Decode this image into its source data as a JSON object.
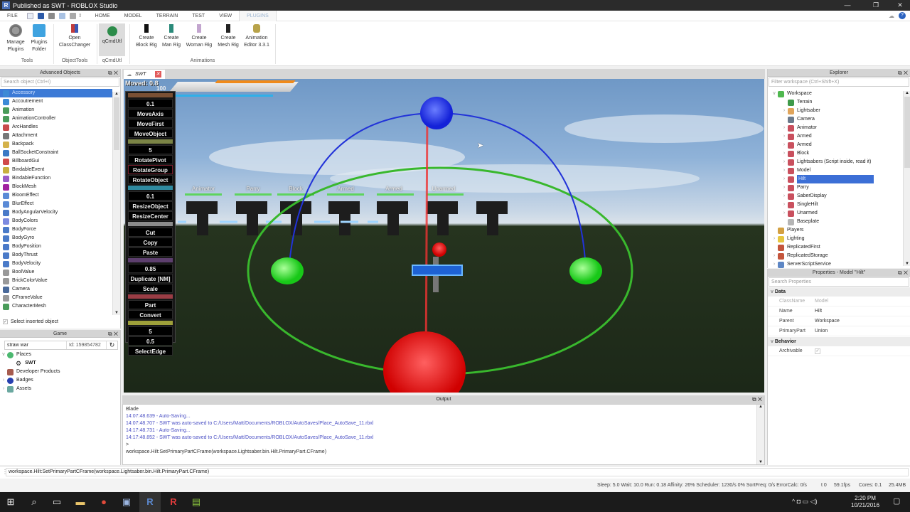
{
  "window": {
    "title": "Published as SWT - ROBLOX Studio",
    "logo": "R"
  },
  "menu": {
    "file": "FILE",
    "tabs": [
      "HOME",
      "MODEL",
      "TERRAIN",
      "TEST",
      "VIEW",
      "PLUGINS"
    ],
    "active_tab": "PLUGINS"
  },
  "ribbon": {
    "buttons": [
      {
        "label1": "Manage",
        "label2": "Plugins",
        "icon": "plug-icon"
      },
      {
        "label1": "Plugins",
        "label2": "Folder",
        "icon": "folder-icon"
      },
      {
        "label1": "Open",
        "label2": "ClassChanger",
        "icon": "class-changer-icon"
      },
      {
        "label1": "qCmdUtl",
        "label2": "",
        "icon": "qcmdutl-icon"
      },
      {
        "label1": "Create",
        "label2": "Block Rig",
        "icon": "block-rig-icon"
      },
      {
        "label1": "Create",
        "label2": "Man Rig",
        "icon": "man-rig-icon"
      },
      {
        "label1": "Create",
        "label2": "Woman Rig",
        "icon": "woman-rig-icon"
      },
      {
        "label1": "Create",
        "label2": "Mesh Rig",
        "icon": "mesh-rig-icon"
      },
      {
        "label1": "Animation",
        "label2": "Editor 3.3.1",
        "icon": "animation-editor-icon"
      }
    ],
    "groups": [
      "Tools",
      "ObjectTools",
      "qCmdUtl",
      "Animations"
    ]
  },
  "advanced_objects": {
    "title": "Advanced Objects",
    "search_placeholder": "Search object (Ctrl+I)",
    "items": [
      "Accessory",
      "Accoutrement",
      "Animation",
      "AnimationController",
      "ArcHandles",
      "Attachment",
      "Backpack",
      "BallSocketConstraint",
      "BillboardGui",
      "BindableEvent",
      "BindableFunction",
      "BlockMesh",
      "BloomEffect",
      "BlurEffect",
      "BodyAngularVelocity",
      "BodyColors",
      "BodyForce",
      "BodyGyro",
      "BodyPosition",
      "BodyThrust",
      "BodyVelocity",
      "BoolValue",
      "BrickColorValue",
      "Camera",
      "CFrameValue",
      "CharacterMesh"
    ],
    "selected": "Accessory",
    "select_inserted_label": "Select inserted object",
    "select_inserted_checked": true
  },
  "game": {
    "title": "Game",
    "name_value": "straw war",
    "id_label": "Id: 159854782",
    "tree": [
      {
        "label": "Places",
        "expanded": true,
        "level": 0
      },
      {
        "label": "SWT",
        "level": 1
      },
      {
        "label": "Developer Products",
        "level": 0
      },
      {
        "label": "Badges",
        "level": 0
      },
      {
        "label": "Assets",
        "level": 0
      }
    ]
  },
  "doc_tab": {
    "label": "SWT"
  },
  "viewport": {
    "moved_label": "Moved: 0.8",
    "moved_value": "100",
    "character_labels": [
      "Animator",
      "Parry",
      "Block",
      "Armed",
      "Armed",
      "Unarmed"
    ],
    "cmd_panel": {
      "groups": [
        {
          "color": "#7a5034",
          "items": [
            "0.1",
            "MoveAxis",
            "MoveFirst",
            "MoveObject"
          ]
        },
        {
          "color": "#7b8446",
          "items": [
            "5",
            "RotatePivot",
            "RotateGroup",
            "RotateObject"
          ]
        },
        {
          "color": "#2f8aa0",
          "items": [
            "0.1",
            "ResizeObject",
            "ResizeCenter"
          ]
        },
        {
          "color": "#8c8c8c",
          "items": [
            "Cut",
            "Copy",
            "Paste"
          ]
        },
        {
          "color": "#5d3f6e",
          "items": [
            "0.85",
            "Duplicate [NM]",
            "Scale"
          ]
        },
        {
          "color": "#9b3d45",
          "items": [
            "Part",
            "Convert"
          ]
        },
        {
          "color": "#9ea03a",
          "items": [
            "5",
            "0.5",
            "SelectEdge"
          ]
        }
      ]
    }
  },
  "explorer": {
    "title": "Explorer",
    "filter_placeholder": "Filter workspace (Ctrl+Shift+X)",
    "items": [
      {
        "label": "Workspace",
        "level": 0,
        "arrow": "v",
        "icon": "#4fb84f"
      },
      {
        "label": "Terrain",
        "level": 1,
        "arrow": "",
        "icon": "#3f9a4a"
      },
      {
        "label": "Lightsaber",
        "level": 1,
        "arrow": ">",
        "icon": "#e0a55c"
      },
      {
        "label": "Camera",
        "level": 1,
        "arrow": "",
        "icon": "#6b7a8c"
      },
      {
        "label": "Animator",
        "level": 1,
        "arrow": ">",
        "icon": "#c9505e"
      },
      {
        "label": "Armed",
        "level": 1,
        "arrow": ">",
        "icon": "#c9505e"
      },
      {
        "label": "Armed",
        "level": 1,
        "arrow": ">",
        "icon": "#c9505e"
      },
      {
        "label": "Block",
        "level": 1,
        "arrow": ">",
        "icon": "#c9505e"
      },
      {
        "label": "Lightsabers (Script inside, read it)",
        "level": 1,
        "arrow": ">",
        "icon": "#c9505e"
      },
      {
        "label": "Model",
        "level": 1,
        "arrow": ">",
        "icon": "#c9505e"
      },
      {
        "label": "Hilt",
        "level": 1,
        "arrow": ">",
        "icon": "#c9505e",
        "selected": true
      },
      {
        "label": "Parry",
        "level": 1,
        "arrow": ">",
        "icon": "#c9505e"
      },
      {
        "label": "SaberDisplay",
        "level": 1,
        "arrow": ">",
        "icon": "#c9505e"
      },
      {
        "label": "SingleHilt",
        "level": 1,
        "arrow": ">",
        "icon": "#c9505e"
      },
      {
        "label": "Unarmed",
        "level": 1,
        "arrow": ">",
        "icon": "#c9505e"
      },
      {
        "label": "Baseplate",
        "level": 1,
        "arrow": "",
        "icon": "#b5b5b5"
      },
      {
        "label": "Players",
        "level": 0,
        "arrow": "",
        "icon": "#d3a042"
      },
      {
        "label": "Lighting",
        "level": 0,
        "arrow": ">",
        "icon": "#e6c640"
      },
      {
        "label": "ReplicatedFirst",
        "level": 0,
        "arrow": "",
        "icon": "#c4553c"
      },
      {
        "label": "ReplicatedStorage",
        "level": 0,
        "arrow": ">",
        "icon": "#c4553c"
      },
      {
        "label": "ServerScriptService",
        "level": 0,
        "arrow": ">",
        "icon": "#5d86c4"
      }
    ]
  },
  "properties": {
    "title": "Properties - Model \"Hilt\"",
    "search_placeholder": "Search Properties",
    "sections": [
      {
        "name": "Data",
        "rows": [
          {
            "key": "ClassName",
            "value": "Model",
            "disabled": true
          },
          {
            "key": "Name",
            "value": "Hilt"
          },
          {
            "key": "Parent",
            "value": "Workspace"
          },
          {
            "key": "PrimaryPart",
            "value": "Union"
          }
        ]
      },
      {
        "name": "Behavior",
        "rows": [
          {
            "key": "Archivable",
            "value": "",
            "checkbox": true
          }
        ]
      }
    ]
  },
  "output": {
    "title": "Output",
    "lines": [
      {
        "text": "Blade",
        "color": "#333333"
      },
      {
        "text": "14:07:48.639 - Auto-Saving...",
        "color": "#4a4fc4"
      },
      {
        "text": "14:07:48.707 - SWT was auto-saved to C:/Users/Matt/Documents/ROBLOX/AutoSaves/Place_AutoSave_11.rbxl",
        "color": "#4a4fc4"
      },
      {
        "text": "14:17:48.731 - Auto-Saving...",
        "color": "#4a4fc4"
      },
      {
        "text": "14:17:48.852 - SWT was auto-saved to C:/Users/Matt/Documents/ROBLOX/AutoSaves/Place_AutoSave_11.rbxl",
        "color": "#4a4fc4"
      },
      {
        "text": ">",
        "color": "#333333"
      },
      {
        "text": "workspace.Hilt:SetPrimaryPartCFrame(workspace.Lightsaber.bin.Hilt.PrimaryPart.CFrame)",
        "color": "#333333"
      }
    ]
  },
  "command_bar": {
    "value": "workspace.Hilt:SetPrimaryPartCFrame(workspace.Lightsaber.bin.Hilt.PrimaryPart.CFrame)"
  },
  "status": {
    "stats": "Sleep: 5.0 Wait: 10.0 Run: 0.18 Affinity: 26% Scheduler: 1230/s 0% SortFreq: 0/s ErrorCalc: 0/s",
    "t": "t 0",
    "fps": "59.1fps",
    "cores": "Cores: 0.1",
    "mem": "25.4MB"
  },
  "taskbar": {
    "time": "2:20 PM",
    "date": "10/21/2016"
  }
}
